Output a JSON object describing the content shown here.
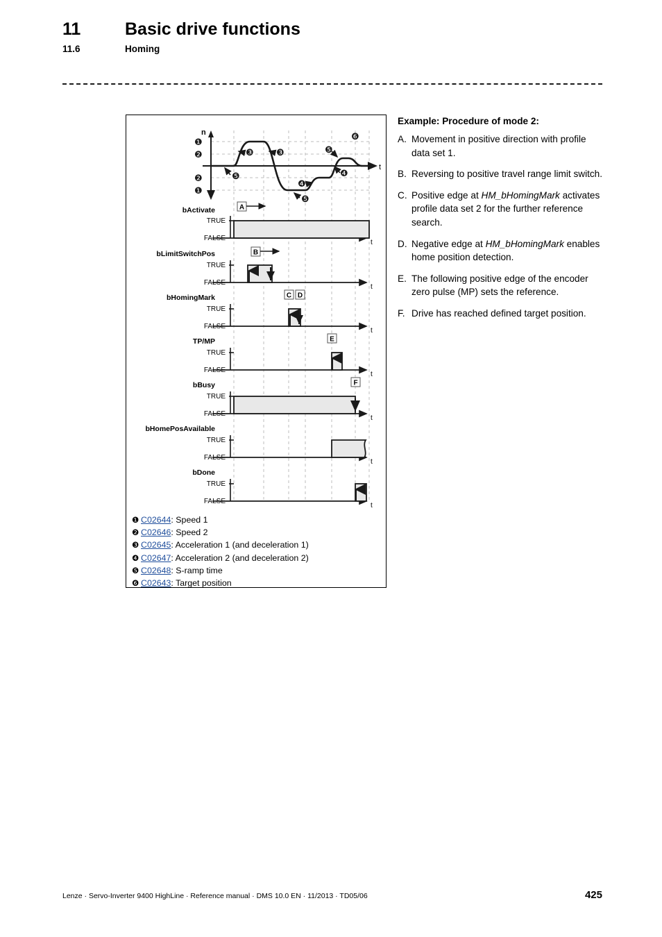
{
  "header": {
    "chapter_number": "11",
    "chapter_title": "Basic drive functions",
    "section_number": "11.6",
    "section_title": "Homing"
  },
  "figure": {
    "speed_axis_y_label": "n",
    "time_axis_label": "t",
    "level_labels": [
      "TRUE",
      "FALSE"
    ],
    "signals": [
      {
        "name": "bActivate",
        "marker": "A"
      },
      {
        "name": "bLimitSwitchPos",
        "marker": "B"
      },
      {
        "name": "bHomingMark",
        "marker": "C",
        "marker2": "D"
      },
      {
        "name": "TP/MP",
        "marker": "E"
      },
      {
        "name": "bBusy",
        "marker": "F"
      },
      {
        "name": "bHomePosAvailable",
        "marker": ""
      },
      {
        "name": "bDone",
        "marker": ""
      }
    ],
    "curve_callouts": [
      "1",
      "2",
      "2",
      "1",
      "3",
      "3",
      "5",
      "5",
      "4",
      "4",
      "5",
      "5",
      "6"
    ],
    "legend": [
      {
        "bullet": "❶",
        "code": "C02644",
        "text": ": Speed 1"
      },
      {
        "bullet": "❷",
        "code": "C02646",
        "text": ": Speed 2"
      },
      {
        "bullet": "❸",
        "code": "C02645",
        "text": ": Acceleration 1 (and deceleration 1)"
      },
      {
        "bullet": "❹",
        "code": "C02647",
        "text": ": Acceleration 2 (and deceleration 2)"
      },
      {
        "bullet": "❺",
        "code": "C02648",
        "text": ": S-ramp time"
      },
      {
        "bullet": "❻",
        "code": "C02643",
        "text": ": Target position"
      }
    ]
  },
  "example": {
    "title": "Example: Procedure of mode 2:",
    "items": [
      {
        "letter": "A.",
        "text_before": "Movement in positive direction with profile data set 1.",
        "italic": "",
        "text_after": ""
      },
      {
        "letter": "B.",
        "text_before": "Reversing to positive travel range limit switch.",
        "italic": "",
        "text_after": ""
      },
      {
        "letter": "C.",
        "text_before": "Positive edge at ",
        "italic": "HM_bHomingMark",
        "text_after": " activates profile data set 2 for the further reference search."
      },
      {
        "letter": "D.",
        "text_before": "Negative edge at ",
        "italic": "HM_bHomingMark",
        "text_after": " enables home position detection."
      },
      {
        "letter": "E.",
        "text_before": "The following positive edge of the encoder zero pulse (MP) sets the reference.",
        "italic": "",
        "text_after": ""
      },
      {
        "letter": "F.",
        "text_before": "Drive has reached defined target position.",
        "italic": "",
        "text_after": ""
      }
    ]
  },
  "footer": {
    "text": "Lenze · Servo-Inverter 9400 HighLine · Reference manual · DMS 10.0 EN · 11/2013 · TD05/06",
    "page_number": "425"
  },
  "colors": {
    "link": "#1F4E9C",
    "fill": "#e8e8e8",
    "grid": "#bdbdbd",
    "line": "#1a1a1a"
  }
}
